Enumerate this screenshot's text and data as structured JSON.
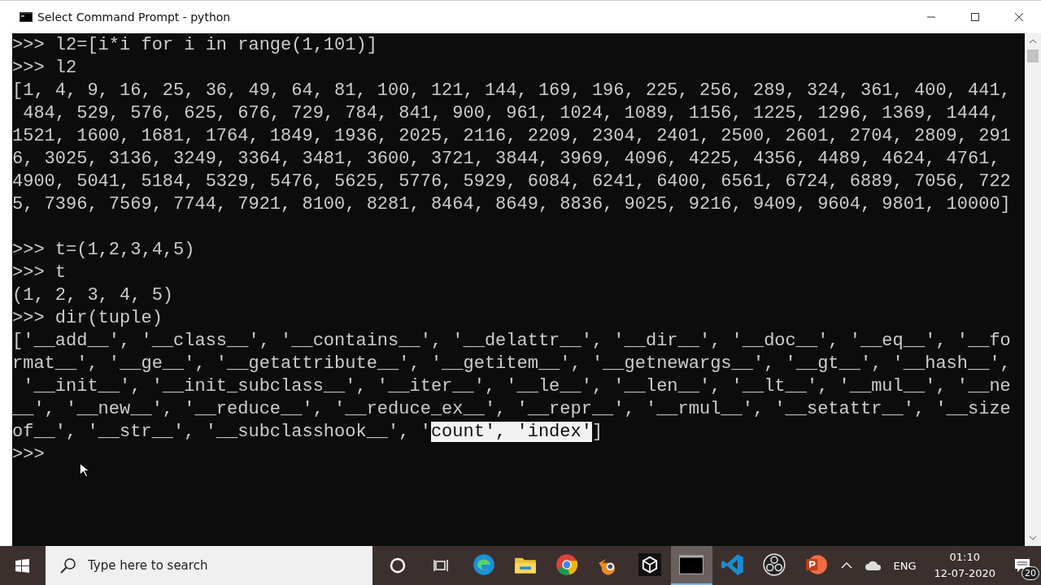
{
  "window": {
    "title": "Select Command Prompt - python"
  },
  "console": {
    "blocks": [
      {
        "lines": [
          {
            "text": ">>> l2=[i*i for i in range(1,101)]"
          },
          {
            "text": ">>> l2"
          },
          {
            "text": "[1, 4, 9, 16, 25, 36, 49, 64, 81, 100, 121, 144, 169, 196, 225, 256, 289, 324, 361, 400, 441,"
          },
          {
            "text": " 484, 529, 576, 625, 676, 729, 784, 841, 900, 961, 1024, 1089, 1156, 1225, 1296, 1369, 1444,"
          },
          {
            "text": "1521, 1600, 1681, 1764, 1849, 1936, 2025, 2116, 2209, 2304, 2401, 2500, 2601, 2704, 2809, 291"
          },
          {
            "text": "6, 3025, 3136, 3249, 3364, 3481, 3600, 3721, 3844, 3969, 4096, 4225, 4356, 4489, 4624, 4761,"
          },
          {
            "text": "4900, 5041, 5184, 5329, 5476, 5625, 5776, 5929, 6084, 6241, 6400, 6561, 6724, 6889, 7056, 722"
          },
          {
            "text": "5, 7396, 7569, 7744, 7921, 8100, 8281, 8464, 8649, 8836, 9025, 9216, 9409, 9604, 9801, 10000]"
          }
        ]
      },
      {
        "lines": [
          {
            "text": ">>> t=(1,2,3,4,5)"
          },
          {
            "text": ">>> t"
          },
          {
            "text": "(1, 2, 3, 4, 5)"
          },
          {
            "text": ">>> dir(tuple)"
          },
          {
            "text": "['__add__', '__class__', '__contains__', '__delattr__', '__dir__', '__doc__', '__eq__', '__fo"
          },
          {
            "text": "rmat__', '__ge__', '__getattribute__', '__getitem__', '__getnewargs__', '__gt__', '__hash__',"
          },
          {
            "text": " '__init__', '__init_subclass__', '__iter__', '__le__', '__len__', '__lt__', '__mul__', '__ne"
          },
          {
            "text": "__', '__new__', '__reduce__', '__reduce_ex__', '__repr__', '__rmul__', '__setattr__', '__size"
          },
          {
            "text": "of__', '__str__', '__subclasshook__', '",
            "selection": "count', 'index'",
            "after": "]"
          },
          {
            "text": ">>>"
          }
        ]
      }
    ]
  },
  "taskbar": {
    "search": {
      "placeholder": "Type here to search"
    },
    "apps": [
      {
        "kind": "edge",
        "selected": false
      },
      {
        "kind": "folder",
        "selected": false
      },
      {
        "kind": "chrome",
        "selected": false
      },
      {
        "kind": "blender",
        "selected": false
      },
      {
        "kind": "unity",
        "selected": false
      },
      {
        "kind": "terminal",
        "selected": true
      },
      {
        "kind": "vscode",
        "selected": false
      },
      {
        "kind": "obs",
        "selected": false
      },
      {
        "kind": "powerpoint",
        "selected": false
      }
    ],
    "language": "ENG",
    "time": "01:10",
    "date": "12-07-2020",
    "notifications": "20"
  }
}
